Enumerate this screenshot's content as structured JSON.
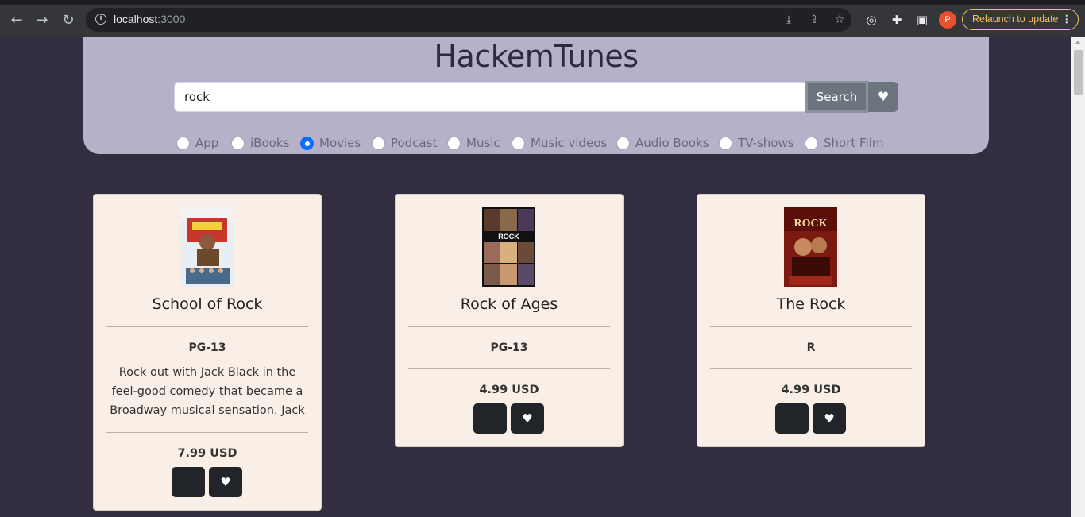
{
  "browser": {
    "url_host": "localhost",
    "url_port": ":3000",
    "relaunch_label": "Relaunch to update",
    "profile_initial": "P"
  },
  "header": {
    "title": "HackemTunes",
    "search_value": "rock",
    "search_button": "Search",
    "media_types": [
      {
        "label": "App",
        "checked": false
      },
      {
        "label": "iBooks",
        "checked": false
      },
      {
        "label": "Movies",
        "checked": true
      },
      {
        "label": "Podcast",
        "checked": false
      },
      {
        "label": "Music",
        "checked": false
      },
      {
        "label": "Music videos",
        "checked": false
      },
      {
        "label": "Audio Books",
        "checked": false
      },
      {
        "label": "TV-shows",
        "checked": false
      },
      {
        "label": "Short Film",
        "checked": false
      }
    ]
  },
  "results": [
    {
      "title": "School of Rock",
      "rating": "PG-13",
      "description": "Rock out with Jack Black in the feel-good comedy that became a Broadway musical sensation. Jack",
      "price": "7.99 USD"
    },
    {
      "title": "Rock of Ages",
      "rating": "PG-13",
      "price": "4.99 USD"
    },
    {
      "title": "The Rock",
      "rating": "R",
      "price": "4.99 USD"
    }
  ],
  "colors": {
    "page_bg": "#332d42",
    "header_bg": "#b4b1c8",
    "card_bg": "#faefe6",
    "button_dark": "#212529",
    "search_button": "#6c757d",
    "radio_checked": "#0d6efd"
  },
  "icons": [
    "back-icon",
    "forward-icon",
    "reload-icon",
    "info-icon",
    "install-icon",
    "share-icon",
    "star-icon",
    "extension-icon",
    "puzzle-icon",
    "sidebar-icon",
    "heart-icon",
    "apple-icon"
  ]
}
